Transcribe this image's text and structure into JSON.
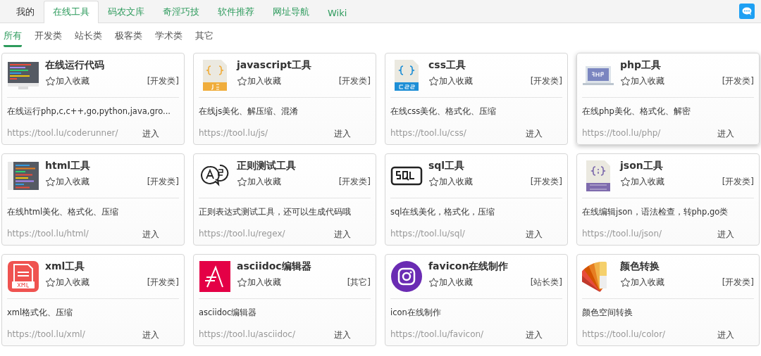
{
  "nav": {
    "tabs": [
      {
        "label": "我的",
        "selected": false
      },
      {
        "label": "在线工具",
        "selected": true
      },
      {
        "label": "码农文库",
        "selected": false
      },
      {
        "label": "奇淫巧技",
        "selected": false
      },
      {
        "label": "软件推荐",
        "selected": false
      },
      {
        "label": "网址导航",
        "selected": false
      },
      {
        "label": "Wiki",
        "selected": false
      }
    ]
  },
  "filters": [
    {
      "label": "所有",
      "selected": true
    },
    {
      "label": "开发类",
      "selected": false
    },
    {
      "label": "站长类",
      "selected": false
    },
    {
      "label": "极客类",
      "selected": false
    },
    {
      "label": "学术类",
      "selected": false
    },
    {
      "label": "其它",
      "selected": false
    }
  ],
  "cards": [
    {
      "kind": "monitor",
      "title": "在线运行代码",
      "favorite": "加入收藏",
      "category": "[开发类]",
      "description": "在线运行php,c,c++,go,python,java,gro...",
      "url": "https://tool.lu/coderunner/",
      "action": "进入",
      "raised": false
    },
    {
      "kind": "js",
      "title": "javascript工具",
      "favorite": "加入收藏",
      "category": "[开发类]",
      "description": "在线js美化、解压缩、混淆",
      "url": "https://tool.lu/js/",
      "action": "进入",
      "raised": false
    },
    {
      "kind": "css",
      "title": "css工具",
      "favorite": "加入收藏",
      "category": "[开发类]",
      "description": "在线css美化、格式化、压缩",
      "url": "https://tool.lu/css/",
      "action": "进入",
      "raised": false
    },
    {
      "kind": "php",
      "title": "php工具",
      "favorite": "加入收藏",
      "category": "[开发类]",
      "description": "在线php美化、格式化、解密",
      "url": "https://tool.lu/php/",
      "action": "进入",
      "raised": true
    },
    {
      "kind": "html",
      "title": "html工具",
      "favorite": "加入收藏",
      "category": "[开发类]",
      "description": "在线html美化、格式化、压缩",
      "url": "https://tool.lu/html/",
      "action": "进入",
      "raised": false
    },
    {
      "kind": "regex",
      "title": "正则测试工具",
      "favorite": "加入收藏",
      "category": "[开发类]",
      "description": "正则表达式测试工具，还可以生成代码哦",
      "url": "https://tool.lu/regex/",
      "action": "进入",
      "raised": false
    },
    {
      "kind": "sql",
      "title": "sql工具",
      "favorite": "加入收藏",
      "category": "[开发类]",
      "description": "sql在线美化，格式化，压缩",
      "url": "https://tool.lu/sql/",
      "action": "进入",
      "raised": false
    },
    {
      "kind": "json",
      "title": "json工具",
      "favorite": "加入收藏",
      "category": "[开发类]",
      "description": "在线编辑json，语法检查，转php,go类",
      "url": "https://tool.lu/json/",
      "action": "进入",
      "raised": false
    },
    {
      "kind": "xml",
      "title": "xml工具",
      "favorite": "加入收藏",
      "category": "[开发类]",
      "description": "xml格式化、压缩",
      "url": "https://tool.lu/xml/",
      "action": "进入",
      "raised": false
    },
    {
      "kind": "asciidoc",
      "title": "asciidoc编辑器",
      "favorite": "加入收藏",
      "category": "[其它]",
      "description": "asciidoc编辑器",
      "url": "https://tool.lu/asciidoc/",
      "action": "进入",
      "raised": false
    },
    {
      "kind": "favicon",
      "title": "favicon在线制作",
      "favorite": "加入收藏",
      "category": "[站长类]",
      "description": "icon在线制作",
      "url": "https://tool.lu/favicon/",
      "action": "进入",
      "raised": false
    },
    {
      "kind": "palette",
      "title": "颜色转换",
      "favorite": "加入收藏",
      "category": "[开发类]",
      "description": "颜色空间转换",
      "url": "https://tool.lu/color/",
      "action": "进入",
      "raised": false
    }
  ]
}
